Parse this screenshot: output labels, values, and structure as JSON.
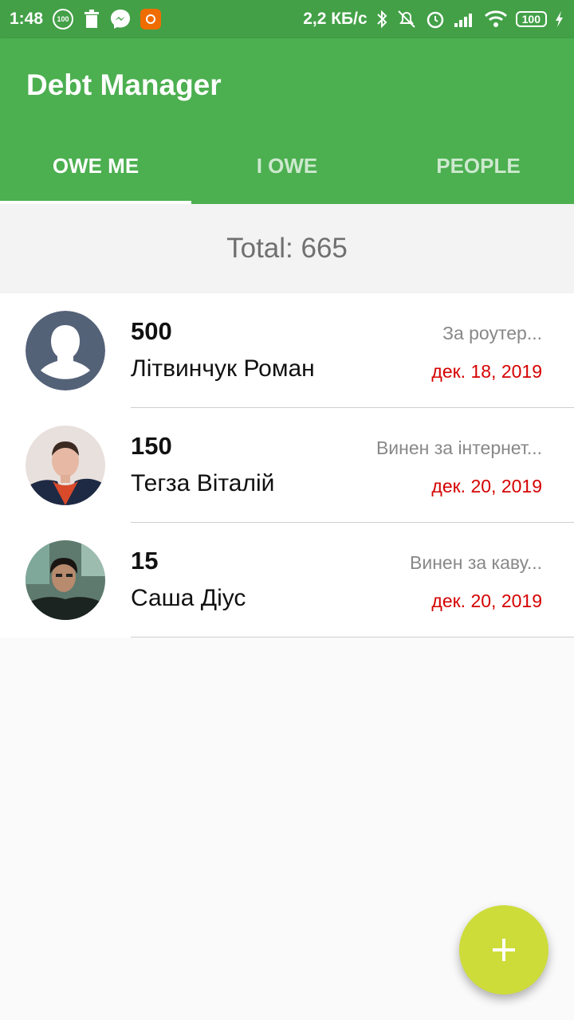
{
  "status_bar": {
    "time": "1:48",
    "notif_badge": "100",
    "network_speed": "2,2 КБ/с",
    "battery": "100"
  },
  "app": {
    "title": "Debt Manager",
    "accent_color": "#4caf50",
    "fab_color": "#cddc39"
  },
  "tabs": [
    {
      "label": "OWE ME",
      "active": true
    },
    {
      "label": "I OWE",
      "active": false
    },
    {
      "label": "PEOPLE",
      "active": false
    }
  ],
  "total_text": "Total: 665",
  "debts": [
    {
      "amount": "500",
      "name": "Літвинчук Роман",
      "note": "За роутер...",
      "date": "дек. 18, 2019",
      "avatar": "default-person-icon"
    },
    {
      "amount": "150",
      "name": "Тегза Віталій",
      "note": "Винен за інтернет...",
      "date": "дек. 20, 2019",
      "avatar": "photo"
    },
    {
      "amount": "15",
      "name": "Саша Діус",
      "note": "Винен за каву...",
      "date": "дек. 20, 2019",
      "avatar": "photo"
    }
  ],
  "fab_icon": "plus-icon"
}
